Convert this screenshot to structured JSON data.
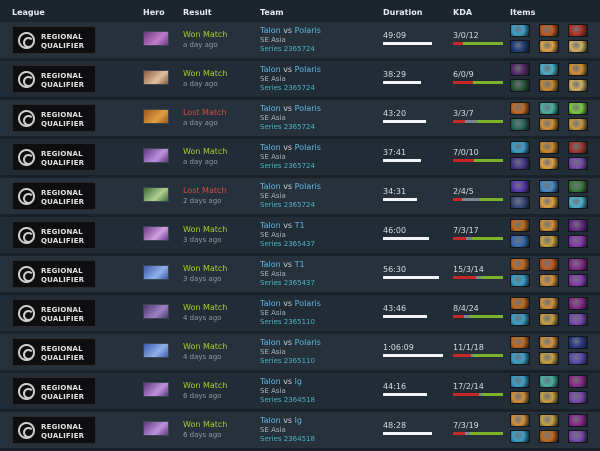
{
  "header": {
    "league": "League",
    "hero": "Hero",
    "result": "Result",
    "team": "Team",
    "duration": "Duration",
    "kda": "KDA",
    "items": "Items"
  },
  "league_badge": {
    "line1": "REGIONAL",
    "line2": "QUALIFIER",
    "icon": "dota-ring-logo"
  },
  "matches": [
    {
      "result": "Won Match",
      "won": true,
      "ago": "a day ago",
      "team1": "Talon",
      "team2": "Polaris",
      "region": "SE Asia",
      "series": "Series 2365724",
      "duration": "49:09",
      "dur_frac": 0.82,
      "kda": "3/0/12",
      "k": 3,
      "d": 0,
      "a": 12,
      "hero_colors": [
        "#6a3a7a",
        "#c27bd0"
      ],
      "item_colors": [
        "#3aa0c8",
        "#c25a1e",
        "#b0321e",
        "#1f3f7a",
        "#e2a040",
        "#d4b060"
      ]
    },
    {
      "result": "Won Match",
      "won": true,
      "ago": "a day ago",
      "team1": "Talon",
      "team2": "Polaris",
      "region": "SE Asia",
      "series": "Series 2365724",
      "duration": "38:29",
      "dur_frac": 0.64,
      "kda": "6/0/9",
      "k": 6,
      "d": 0,
      "a": 9,
      "hero_colors": [
        "#8a5a3a",
        "#e0c0a0"
      ],
      "item_colors": [
        "#5a2a6a",
        "#4ab0c8",
        "#d49030",
        "#2a5a3a",
        "#c88a30",
        "#d4b060"
      ]
    },
    {
      "result": "Lost Match",
      "won": false,
      "ago": "a day ago",
      "team1": "Talon",
      "team2": "Polaris",
      "region": "SE Asia",
      "series": "Series 2365724",
      "duration": "43:20",
      "dur_frac": 0.72,
      "kda": "3/3/7",
      "k": 3,
      "d": 3,
      "a": 7,
      "hero_colors": [
        "#a0541e",
        "#e0a040"
      ],
      "item_colors": [
        "#c26a1e",
        "#4ab0a0",
        "#7ac83a",
        "#2a6a5a",
        "#d49030",
        "#c89a40"
      ]
    },
    {
      "result": "Won Match",
      "won": true,
      "ago": "a day ago",
      "team1": "Talon",
      "team2": "Polaris",
      "region": "SE Asia",
      "series": "Series 2365724",
      "duration": "37:41",
      "dur_frac": 0.63,
      "kda": "7/0/10",
      "k": 7,
      "d": 0,
      "a": 10,
      "hero_colors": [
        "#5a3a7a",
        "#c090e0"
      ],
      "item_colors": [
        "#3aa0c8",
        "#d08a2a",
        "#a03a2a",
        "#4a3a8a",
        "#e0a040",
        "#7a4ab0"
      ]
    },
    {
      "result": "Lost Match",
      "won": false,
      "ago": "2 days ago",
      "team1": "Talon",
      "team2": "Polaris",
      "region": "SE Asia",
      "series": "Series 2365724",
      "duration": "34:31",
      "dur_frac": 0.57,
      "kda": "2/4/5",
      "k": 2,
      "d": 4,
      "a": 5,
      "hero_colors": [
        "#3a6a3a",
        "#b0d090"
      ],
      "item_colors": [
        "#5a3ab0",
        "#4a8ac8",
        "#3a7a3a",
        "#3a4a7a",
        "#e0a040",
        "#4ab0c8"
      ]
    },
    {
      "result": "Won Match",
      "won": true,
      "ago": "3 days ago",
      "team1": "Talon",
      "team2": "T1",
      "region": "SE Asia",
      "series": "Series 2365437",
      "duration": "46:00",
      "dur_frac": 0.77,
      "kda": "7/3/17",
      "k": 7,
      "d": 3,
      "a": 17,
      "hero_colors": [
        "#6a3a8a",
        "#d0a0e0"
      ],
      "item_colors": [
        "#c26a1e",
        "#d4903a",
        "#6a2a8a",
        "#3a6ab0",
        "#c8a040",
        "#8a3ab0"
      ]
    },
    {
      "result": "Won Match",
      "won": true,
      "ago": "3 days ago",
      "team1": "Talon",
      "team2": "T1",
      "region": "SE Asia",
      "series": "Series 2365437",
      "duration": "56:30",
      "dur_frac": 0.94,
      "kda": "15/3/14",
      "k": 15,
      "d": 3,
      "a": 14,
      "hero_colors": [
        "#3a5ab0",
        "#90b0e8"
      ],
      "item_colors": [
        "#c26a1e",
        "#c25a1e",
        "#8a2a8a",
        "#3aa0c8",
        "#d4903a",
        "#8a3ab0"
      ]
    },
    {
      "result": "Won Match",
      "won": true,
      "ago": "4 days ago",
      "team1": "Talon",
      "team2": "Polaris",
      "region": "SE Asia",
      "series": "Series 2365110",
      "duration": "43:46",
      "dur_frac": 0.73,
      "kda": "8/4/24",
      "k": 8,
      "d": 4,
      "a": 24,
      "hero_colors": [
        "#4a3a6a",
        "#a080c8"
      ],
      "item_colors": [
        "#c26a1e",
        "#d4903a",
        "#8a2a8a",
        "#3aa0c8",
        "#c8a040",
        "#7a4ab0"
      ]
    },
    {
      "result": "Won Match",
      "won": true,
      "ago": "4 days ago",
      "team1": "Talon",
      "team2": "Polaris",
      "region": "SE Asia",
      "series": "Series 2365110",
      "duration": "1:06:09",
      "dur_frac": 1.0,
      "kda": "11/1/18",
      "k": 11,
      "d": 1,
      "a": 18,
      "hero_colors": [
        "#3a5ab0",
        "#90b0e8"
      ],
      "item_colors": [
        "#c26a1e",
        "#d4903a",
        "#2a3a8a",
        "#3aa0c8",
        "#c8a040",
        "#5a4ab0"
      ]
    },
    {
      "result": "Won Match",
      "won": true,
      "ago": "6 days ago",
      "team1": "Talon",
      "team2": "lg",
      "region": "SE Asia",
      "series": "Series 2364518",
      "duration": "44:16",
      "dur_frac": 0.74,
      "kda": "17/2/14",
      "k": 17,
      "d": 2,
      "a": 14,
      "hero_colors": [
        "#5a3a7a",
        "#c090e0"
      ],
      "item_colors": [
        "#3aa0c8",
        "#4ab0a0",
        "#8a2a8a",
        "#d4903a",
        "#c8a040",
        "#7a4ab0"
      ]
    },
    {
      "result": "Won Match",
      "won": true,
      "ago": "6 days ago",
      "team1": "Talon",
      "team2": "lg",
      "region": "SE Asia",
      "series": "Series 2364518",
      "duration": "48:28",
      "dur_frac": 0.81,
      "kda": "7/3/19",
      "k": 7,
      "d": 3,
      "a": 19,
      "hero_colors": [
        "#5a3a7a",
        "#c090e0"
      ],
      "item_colors": [
        "#d4903a",
        "#c8a040",
        "#8a2a8a",
        "#3aa0c8",
        "#c26a1e",
        "#7a4ab0"
      ]
    }
  ]
}
